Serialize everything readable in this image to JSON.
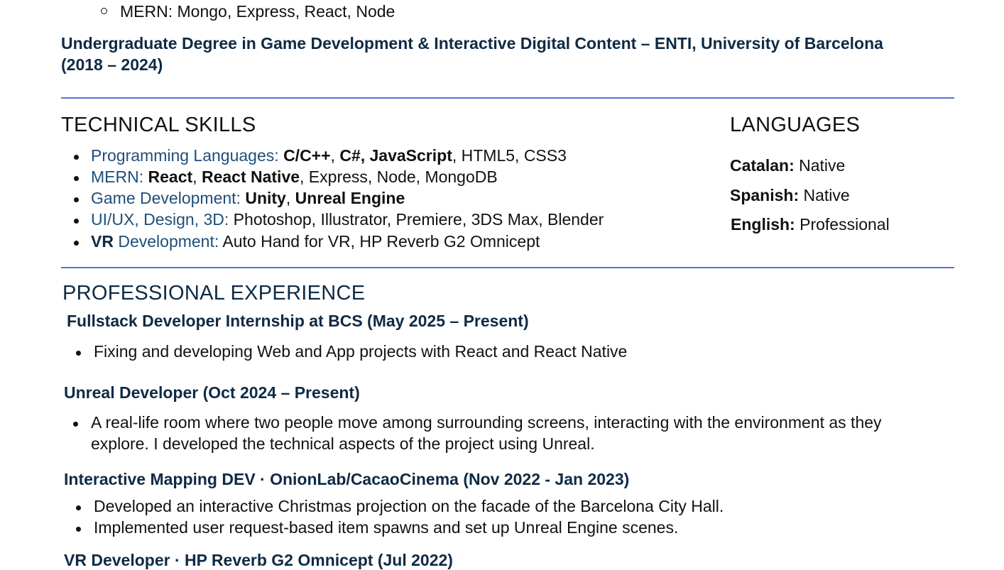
{
  "top_subbullet": "MERN: Mongo, Express, React, Node",
  "degree": {
    "line1": "Undergraduate Degree in Game Development & Interactive Digital Content – ENTI, University of Barcelona",
    "line2": "(2018 – 2024)"
  },
  "technical_skills": {
    "title": "TECHNICAL SKILLS",
    "items": [
      {
        "category": "Programming Languages:",
        "bold_1": "C/C++",
        "sep_1": ", ",
        "bold_2": "C#, JavaScript",
        "rest": ", HTML5, CSS3"
      },
      {
        "category": "MERN:",
        "bold_1": "React",
        "sep_1": ", ",
        "bold_2": "React Native",
        "rest": ", Express, Node, MongoDB"
      },
      {
        "category": "Game Development:",
        "bold_1": "Unity",
        "sep_1": ", ",
        "bold_2": "Unreal Engine",
        "rest": ""
      },
      {
        "category": "UI/UX, Design, 3D:",
        "rest": " Photoshop, Illustrator, Premiere, 3DS Max, Blender"
      },
      {
        "bold_prefix": "VR",
        "category": " Development:",
        "rest": " Auto Hand for VR, HP Reverb G2 Omnicept"
      }
    ]
  },
  "languages": {
    "title": "LANGUAGES",
    "items": [
      {
        "name": "Catalan:",
        "level": "Native"
      },
      {
        "name": "Spanish:",
        "level": "Native"
      },
      {
        "name": "English:",
        "level": "Professional"
      }
    ]
  },
  "experience": {
    "title": "PROFESSIONAL EXPERIENCE",
    "jobs": [
      {
        "heading": "Fullstack Developer Internship at BCS (May 2025 – Present)",
        "bullets": [
          "Fixing and developing Web and App projects with React and React Native"
        ]
      },
      {
        "heading": "Unreal Developer (Oct 2024 – Present)",
        "bullets": [
          "A real-life room where two people move among surrounding screens, interacting with the environment as they",
          "explore. I developed the technical aspects of the project using Unreal."
        ]
      },
      {
        "heading": "Interactive Mapping DEV · OnionLab/CacaoCinema (Nov 2022 - Jan 2023)",
        "bullets": [
          "Developed an interactive Christmas projection on the facade of the Barcelona City Hall.",
          "Implemented user request-based item spawns and set up Unreal Engine scenes."
        ]
      },
      {
        "heading": "VR Developer · HP Reverb G2 Omnicept (Jul 2022)"
      }
    ]
  }
}
